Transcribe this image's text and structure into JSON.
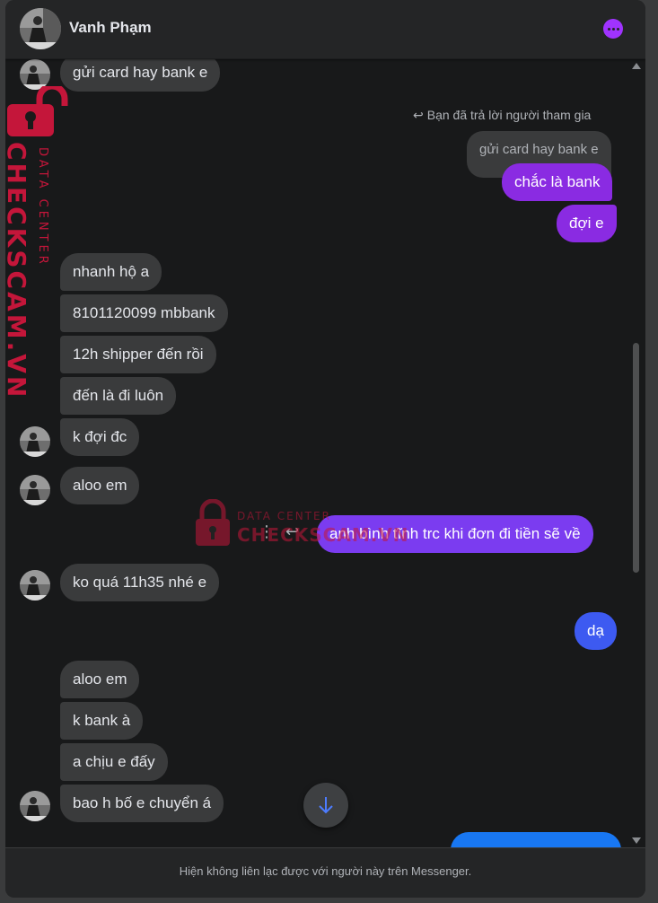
{
  "header": {
    "contact_name": "Vanh Phạm",
    "more_icon": "more-options-icon",
    "accent_color": "#a033ff"
  },
  "reply_note": "Bạn đã trả lời người tham gia",
  "quoted_message": "gửi card hay bank e",
  "messages": [
    {
      "side": "in",
      "text": "gửi card hay bank e"
    },
    {
      "side": "out",
      "text": "chắc là bank"
    },
    {
      "side": "out",
      "text": "đợi e"
    },
    {
      "side": "in",
      "text": "nhanh hộ a"
    },
    {
      "side": "in",
      "text": "8101120099 mbbank"
    },
    {
      "side": "in",
      "text": "12h shipper đến rồi"
    },
    {
      "side": "in",
      "text": "đến là đi luôn"
    },
    {
      "side": "in",
      "text": "k đợi đc"
    },
    {
      "side": "in",
      "text": "aloo em"
    },
    {
      "side": "out",
      "text": "anh bình tĩnh trc khi đơn đi tiền sẽ về"
    },
    {
      "side": "in",
      "text": "ko quá 11h35 nhé e"
    },
    {
      "side": "out",
      "text": "dạ"
    },
    {
      "side": "in",
      "text": "aloo em"
    },
    {
      "side": "in",
      "text": "k bank à"
    },
    {
      "side": "in",
      "text": "a chịu e đấy"
    },
    {
      "side": "in",
      "text": "bao h bố e chuyển á"
    }
  ],
  "footer_notice": "Hiện không liên lạc được với người này trên Messenger.",
  "watermark": {
    "brand": "CHECKSCAM.VN",
    "tagline": "DATA CENTER",
    "color": "#c4163a"
  },
  "colors": {
    "incoming_bubble": "#3a3b3c",
    "outgoing_purple": "#8a2be2",
    "outgoing_blue": "#3d5af1",
    "outgoing_bright_blue": "#1877f2",
    "background": "#18191a"
  }
}
